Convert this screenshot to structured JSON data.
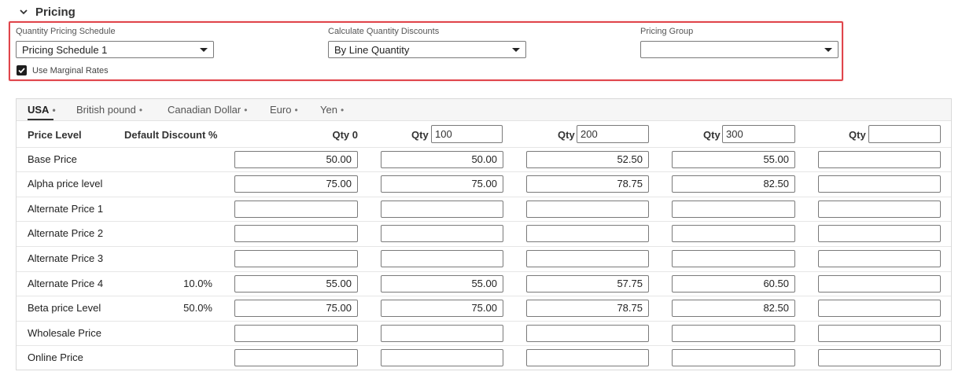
{
  "section": {
    "title": "Pricing"
  },
  "fields": {
    "schedule": {
      "label": "Quantity Pricing Schedule",
      "value": "Pricing Schedule 1"
    },
    "calc": {
      "label": "Calculate Quantity Discounts",
      "value": "By Line Quantity"
    },
    "group": {
      "label": "Pricing Group",
      "value": ""
    },
    "marginal": {
      "label": "Use Marginal Rates",
      "checked": true
    }
  },
  "tabs": [
    {
      "label": "USA",
      "dot": "•",
      "active": true
    },
    {
      "label": "British pound",
      "dot": "•"
    },
    {
      "label": "Canadian Dollar",
      "dot": "•"
    },
    {
      "label": "Euro",
      "dot": "•"
    },
    {
      "label": "Yen",
      "dot": "•"
    }
  ],
  "table": {
    "price_level_header": "Price Level",
    "discount_header": "Default Discount %",
    "qty_prefix": "Qty",
    "qty0_header": "Qty 0",
    "qty_values": [
      "100",
      "200",
      "300",
      ""
    ],
    "rows": [
      {
        "label": "Base Price",
        "discount": "",
        "values": [
          "50.00",
          "50.00",
          "52.50",
          "55.00",
          ""
        ]
      },
      {
        "label": "Alpha price level",
        "discount": "",
        "values": [
          "75.00",
          "75.00",
          "78.75",
          "82.50",
          ""
        ]
      },
      {
        "label": "Alternate Price 1",
        "discount": "",
        "values": [
          "",
          "",
          "",
          "",
          ""
        ]
      },
      {
        "label": "Alternate Price 2",
        "discount": "",
        "values": [
          "",
          "",
          "",
          "",
          ""
        ]
      },
      {
        "label": "Alternate Price 3",
        "discount": "",
        "values": [
          "",
          "",
          "",
          "",
          ""
        ]
      },
      {
        "label": "Alternate Price 4",
        "discount": "10.0%",
        "values": [
          "55.00",
          "55.00",
          "57.75",
          "60.50",
          ""
        ]
      },
      {
        "label": "Beta price Level",
        "discount": "50.0%",
        "values": [
          "75.00",
          "75.00",
          "78.75",
          "82.50",
          ""
        ]
      },
      {
        "label": "Wholesale Price",
        "discount": "",
        "values": [
          "",
          "",
          "",
          "",
          ""
        ]
      },
      {
        "label": "Online Price",
        "discount": "",
        "values": [
          "",
          "",
          "",
          "",
          ""
        ]
      }
    ]
  }
}
